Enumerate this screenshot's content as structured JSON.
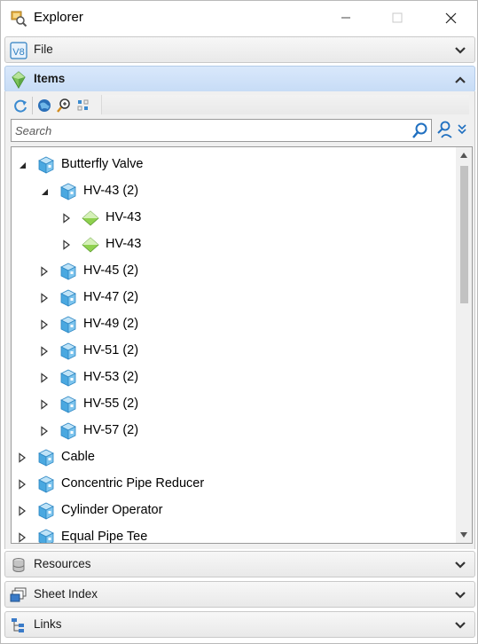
{
  "window": {
    "title": "Explorer"
  },
  "sections": {
    "file": {
      "label": "File",
      "icon": "v8-icon"
    },
    "items": {
      "label": "Items",
      "icon": "green-gem-icon"
    },
    "resources": {
      "label": "Resources",
      "icon": "database-icon"
    },
    "sheet_index": {
      "label": "Sheet Index",
      "icon": "sheets-icon"
    },
    "links": {
      "label": "Links",
      "icon": "tree-links-icon"
    }
  },
  "toolbar": {
    "buttons": [
      "refresh-icon",
      "globe-icon",
      "zoom-icon",
      "grid-icon"
    ]
  },
  "search": {
    "placeholder": "Search",
    "value": ""
  },
  "tree": {
    "nodes": [
      {
        "label": "Butterfly Valve",
        "level": 0,
        "expanded": true,
        "icon": "cube-icon"
      },
      {
        "label": "HV-43 (2)",
        "level": 1,
        "expanded": true,
        "icon": "cube-icon"
      },
      {
        "label": "HV-43",
        "level": 2,
        "expanded": false,
        "icon": "diamond-icon"
      },
      {
        "label": "HV-43",
        "level": 2,
        "expanded": false,
        "icon": "diamond-icon"
      },
      {
        "label": "HV-45 (2)",
        "level": 1,
        "expanded": false,
        "icon": "cube-icon"
      },
      {
        "label": "HV-47 (2)",
        "level": 1,
        "expanded": false,
        "icon": "cube-icon"
      },
      {
        "label": "HV-49 (2)",
        "level": 1,
        "expanded": false,
        "icon": "cube-icon"
      },
      {
        "label": "HV-51 (2)",
        "level": 1,
        "expanded": false,
        "icon": "cube-icon"
      },
      {
        "label": "HV-53 (2)",
        "level": 1,
        "expanded": false,
        "icon": "cube-icon"
      },
      {
        "label": "HV-55 (2)",
        "level": 1,
        "expanded": false,
        "icon": "cube-icon"
      },
      {
        "label": "HV-57 (2)",
        "level": 1,
        "expanded": false,
        "icon": "cube-icon"
      },
      {
        "label": "Cable",
        "level": 0,
        "expanded": false,
        "icon": "cube-icon"
      },
      {
        "label": "Concentric Pipe Reducer",
        "level": 0,
        "expanded": false,
        "icon": "cube-icon"
      },
      {
        "label": "Cylinder Operator",
        "level": 0,
        "expanded": false,
        "icon": "cube-icon"
      },
      {
        "label": "Equal Pipe Tee",
        "level": 0,
        "expanded": false,
        "icon": "cube-icon"
      }
    ]
  },
  "colors": {
    "active_section": "#c7dcf6",
    "cube_blue": "#4aa8e0",
    "diamond_green": "#8fd14f"
  }
}
